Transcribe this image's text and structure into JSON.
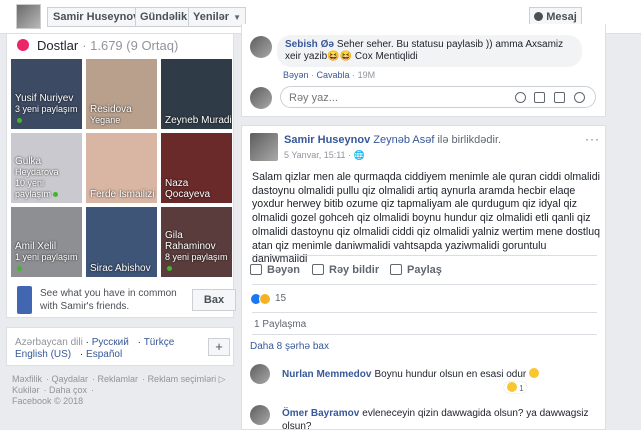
{
  "header": {
    "profile_name": "Samir Huseynov",
    "menu1": "Gündəlik",
    "menu2": "Yenilər",
    "message_button": "Mesaj"
  },
  "friends": {
    "title": "Dostlar",
    "count": "· 1.679 (9 Ortaq)",
    "tiles": [
      {
        "name": "Yusif Nuriyev",
        "sub": "3 yeni paylaşım",
        "bg": "#3d4a63"
      },
      {
        "name": "Residova",
        "name2": "Yegane",
        "sub": "",
        "bg": "#b8a08d"
      },
      {
        "name": "Zeyneb Muradi",
        "sub": "",
        "bg": "#2f3b46"
      },
      {
        "name": "Gulka",
        "name2": "Heydarova",
        "sub": "10 yeni paylaşım",
        "bg": "#c9c9cf"
      },
      {
        "name": "Ferde Ismailizi",
        "sub": "",
        "bg": "#d9b6a3"
      },
      {
        "name": "Naza Qocayeva",
        "sub": "",
        "bg": "#6a2a2a"
      },
      {
        "name": "Amil Xelil",
        "sub": "1 yeni paylaşım",
        "bg": "#8d8f92"
      },
      {
        "name": "Sirac Abishov",
        "sub": "",
        "bg": "#3e5578"
      },
      {
        "name": "Gila Rahaminov",
        "sub": "8 yeni paylaşım",
        "bg": "#5a3c3c"
      }
    ],
    "info_text": "See what you have in common with Samir's friends.",
    "info_button": "Bax"
  },
  "languages": {
    "current": "Azərbaycan dili",
    "links": [
      "Русский",
      "Türkçe",
      "English (US)",
      "Español"
    ],
    "add": "+"
  },
  "footer": {
    "line1": [
      "Məxfilik",
      "Qaydalar",
      "Reklamlar",
      "Reklam seçimləri ▷"
    ],
    "line2": [
      "Kukilər",
      "Daha çox"
    ],
    "copyright": "Facebook © 2018"
  },
  "post1": {
    "comment_author": "Sebish Øə",
    "comment_text": "Seher seher. Bu statusu paylasib )) amma Axsamiz xeir yazib😆😆 Cox Mentiqlidi",
    "like": "Bəyən",
    "reply": "Cavabla",
    "time": "19M",
    "reply_placeholder": "Rəy yaz..."
  },
  "post2": {
    "author": "Samir Huseynov",
    "tagged": "Zeynəb Asəf",
    "with_text": "ilə birlikdədir.",
    "date": "5 Yanvar, 15:11 · ",
    "more": "···",
    "text": "Salam qizlar men ale qurmaqda ciddiyem menimle ale quran ciddi olmalidi dastoynu olmalidi pullu qiz olmalidi artiq aynurla aramda hecbir elaqe yoxdur herwey bitib ozume qiz tapmaliyam ale qurdugum qiz idyal qiz olmalidi gozel gohceh qiz olmalidi boynu hundur qiz olmalidi etli qanli qiz olmalidi dastoynu qiz olmalidi ciddi qiz olmalidi yalniz wertim mene dostluq atan qiz menimle daniwmalidi vahtsapda yaziwmalidi goruntulu daniwmalidi",
    "action_like": "Bəyən",
    "action_comment": "Rəy bildir",
    "action_share": "Paylaş",
    "reactions_count": "15",
    "shares": "1 Paylaşma",
    "more_comments": "Daha 8 şərhə bax",
    "comments": [
      {
        "author": "Nurlan Memmedov",
        "text": "Boynu hundur olsun en esasi odur",
        "reaction_count": "1"
      },
      {
        "author": "Ömer Bayramov",
        "text": "evleneceyin qizin dawwagida olsun? ya dawwagsiz olsun?"
      }
    ]
  }
}
